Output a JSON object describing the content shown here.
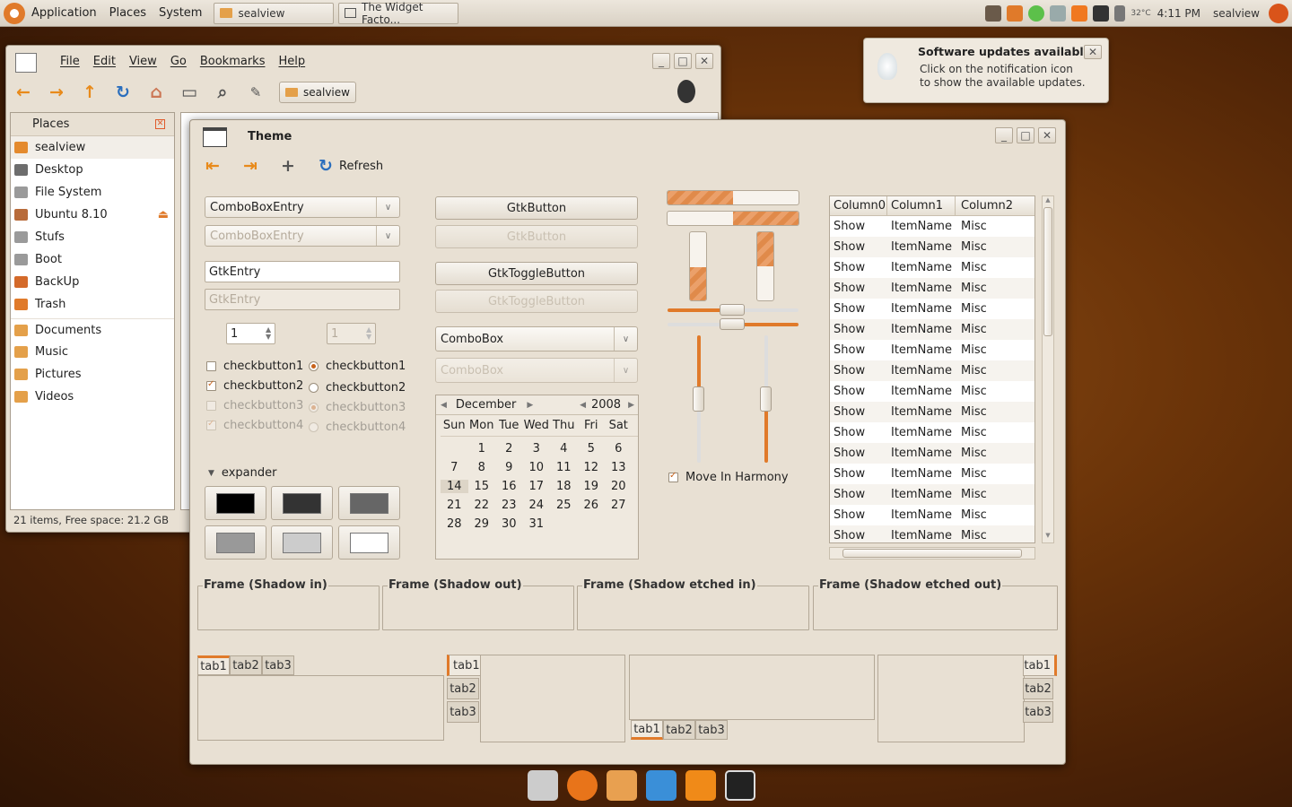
{
  "top_panel": {
    "menus": [
      "Application",
      "Places",
      "System"
    ],
    "tasks": [
      "sealview",
      "The Widget Facto..."
    ],
    "clock": "4:11 PM",
    "user": "sealview",
    "weather": "32°C"
  },
  "notification": {
    "title": "Software updates available",
    "body": "Click on the notification icon to show the available updates."
  },
  "file_manager": {
    "menus": [
      "File",
      "Edit",
      "View",
      "Go",
      "Bookmarks",
      "Help"
    ],
    "location_button": "sealview",
    "sidebar_title": "Places",
    "places": [
      {
        "label": "sealview",
        "icon": "home-folder-icon",
        "color": "#e48a2e"
      },
      {
        "label": "Desktop",
        "icon": "desktop-icon",
        "color": "#6d6d6d"
      },
      {
        "label": "File System",
        "icon": "harddisk-icon",
        "color": "#9a9a9a"
      },
      {
        "label": "Ubuntu 8.10",
        "icon": "cdrom-icon",
        "color": "#b86b3a"
      },
      {
        "label": "Stufs",
        "icon": "drive-icon",
        "color": "#9a9a9a"
      },
      {
        "label": "Boot",
        "icon": "drive-icon",
        "color": "#9a9a9a"
      },
      {
        "label": "BackUp",
        "icon": "usb-drive-icon",
        "color": "#d46a2a"
      },
      {
        "label": "Trash",
        "icon": "trash-icon",
        "color": "#e07a2a"
      },
      {
        "label": "Documents",
        "icon": "folder-icon",
        "color": "#e4a04a"
      },
      {
        "label": "Music",
        "icon": "folder-icon",
        "color": "#e4a04a"
      },
      {
        "label": "Pictures",
        "icon": "folder-icon",
        "color": "#e4a04a"
      },
      {
        "label": "Videos",
        "icon": "folder-icon",
        "color": "#e4a04a"
      }
    ],
    "status": "21 items, Free space: 21.2 GB"
  },
  "theme_window": {
    "title": "Theme",
    "toolbar_refresh": "Refresh",
    "combo_entry": "ComboBoxEntry",
    "combo_entry_disabled": "ComboBoxEntry",
    "entry": "GtkEntry",
    "entry_disabled": "GtkEntry",
    "spin1": "1",
    "spin2": "1",
    "checks": [
      "checkbutton1",
      "checkbutton2",
      "checkbutton3",
      "checkbutton4"
    ],
    "radios": [
      "checkbutton1",
      "checkbutton2",
      "checkbutton3",
      "checkbutton4"
    ],
    "expander": "expander",
    "swatches": [
      "#000000",
      "#333333",
      "#666666",
      "#999999",
      "#cccccc",
      "#ffffff"
    ],
    "button": "GtkButton",
    "button_disabled": "GtkButton",
    "toggle": "GtkToggleButton",
    "toggle_disabled": "GtkToggleButton",
    "combo": "ComboBox",
    "combo_disabled": "ComboBox",
    "calendar": {
      "month": "December",
      "year": "2008",
      "days": [
        "Sun",
        "Mon",
        "Tue",
        "Wed",
        "Thu",
        "Fri",
        "Sat"
      ],
      "weeks": [
        [
          "",
          "1",
          "2",
          "3",
          "4",
          "5",
          "6"
        ],
        [
          "7",
          "8",
          "9",
          "10",
          "11",
          "12",
          "13"
        ],
        [
          "14",
          "15",
          "16",
          "17",
          "18",
          "19",
          "20"
        ],
        [
          "21",
          "22",
          "23",
          "24",
          "25",
          "26",
          "27"
        ],
        [
          "28",
          "29",
          "30",
          "31",
          "",
          "",
          ""
        ]
      ],
      "selected": "14"
    },
    "progress": {
      "h1": 0.5,
      "h2": 0.5,
      "v1": 0.5,
      "v2": 0.5
    },
    "harmony": "Move In Harmony",
    "tree_columns": [
      "Column0",
      "Column1",
      "Column2"
    ],
    "tree_rows": [
      [
        "Show",
        "ItemName",
        "Misc"
      ],
      [
        "Show",
        "ItemName",
        "Misc"
      ],
      [
        "Show",
        "ItemName",
        "Misc"
      ],
      [
        "Show",
        "ItemName",
        "Misc"
      ],
      [
        "Show",
        "ItemName",
        "Misc"
      ],
      [
        "Show",
        "ItemName",
        "Misc"
      ],
      [
        "Show",
        "ItemName",
        "Misc"
      ],
      [
        "Show",
        "ItemName",
        "Misc"
      ],
      [
        "Show",
        "ItemName",
        "Misc"
      ],
      [
        "Show",
        "ItemName",
        "Misc"
      ],
      [
        "Show",
        "ItemName",
        "Misc"
      ],
      [
        "Show",
        "ItemName",
        "Misc"
      ],
      [
        "Show",
        "ItemName",
        "Misc"
      ],
      [
        "Show",
        "ItemName",
        "Misc"
      ],
      [
        "Show",
        "ItemName",
        "Misc"
      ],
      [
        "Show",
        "ItemName",
        "Misc"
      ]
    ],
    "frames": [
      "Frame (Shadow in)",
      "Frame (Shadow out)",
      "Frame (Shadow etched in)",
      "Frame (Shadow etched out)"
    ],
    "tabs": [
      "tab1",
      "tab2",
      "tab3"
    ]
  },
  "dock": [
    "clock-mail-icon",
    "firefox-icon",
    "file-transfer-icon",
    "messenger-icon",
    "vlc-icon",
    "screen-icon"
  ],
  "colors": {
    "accent": "#e07a2a",
    "window_bg": "#e8e0d3",
    "panel_bg": "#ece6dc"
  }
}
